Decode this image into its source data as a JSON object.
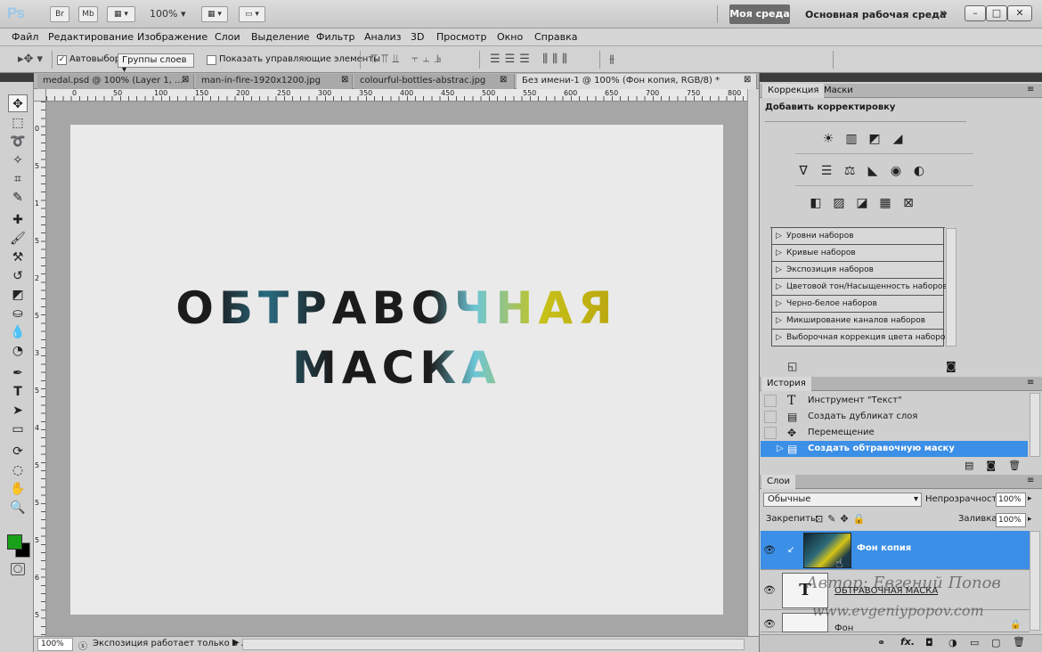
{
  "titlebar": {
    "logo": "Ps",
    "btn_br": "Br",
    "btn_mb": "Mb",
    "zoom": "100%",
    "workspace_active": "Моя среда",
    "workspace_main": "Основная рабочая среда",
    "more": "»",
    "minimize": "–",
    "maximize": "□",
    "close": "✕"
  },
  "menu": [
    "Файл",
    "Редактирование",
    "Изображение",
    "Слои",
    "Выделение",
    "Фильтр",
    "Анализ",
    "3D",
    "Просмотр",
    "Окно",
    "Справка"
  ],
  "options": {
    "auto_select_label": "Автовыбор:",
    "auto_select_value": "Группы слоев",
    "show_controls_label": "Показать управляющие элементы"
  },
  "tabs": [
    {
      "label": "medal.psd @ 100% (Layer 1, ..."
    },
    {
      "label": "man-in-fire-1920x1200.jpg"
    },
    {
      "label": "colourful-bottles-abstrac.jpg"
    },
    {
      "label": "Без имени-1 @ 100% (Фон копия, RGB/8) *"
    }
  ],
  "ruler_top": [
    "0",
    "50",
    "100",
    "150",
    "200",
    "250",
    "300",
    "350",
    "400",
    "450",
    "500",
    "550",
    "600",
    "650",
    "700",
    "750",
    "800"
  ],
  "ruler_left": [
    "0",
    "5",
    "1",
    "5",
    "2",
    "5",
    "3",
    "5",
    "4",
    "5",
    "5",
    "5",
    "6",
    "5"
  ],
  "canvas": {
    "line1": "ОБТРАВОЧНАЯ",
    "line2": "МАСКА"
  },
  "status": {
    "zoom": "100%",
    "text": "Экспозиция работает только в ..."
  },
  "adjustments": {
    "tabs": [
      "Коррекция",
      "Маски"
    ],
    "heading": "Добавить корректировку",
    "row1": [
      "☀",
      "▥",
      "◩",
      "◢"
    ],
    "row2": [
      "∇",
      "☰",
      "⚖",
      "◣",
      "◉",
      "◐"
    ],
    "row3": [
      "◧",
      "▨",
      "◪",
      "▦",
      "⊠"
    ],
    "presets": [
      "Уровни наборов",
      "Кривые наборов",
      "Экспозиция наборов",
      "Цветовой тон/Насыщенность наборов",
      "Черно-белое наборов",
      "Микширование каналов наборов",
      "Выборочная коррекция цвета наборов"
    ]
  },
  "history": {
    "title": "История",
    "items": [
      {
        "label": "Инструмент \"Текст\"",
        "icon": "T"
      },
      {
        "label": "Создать дубликат слоя",
        "icon": "▤"
      },
      {
        "label": "Перемещение",
        "icon": "✥"
      },
      {
        "label": "Создать обтравочную маску",
        "icon": "▤"
      }
    ]
  },
  "layers": {
    "title": "Слои",
    "blend_mode": "Обычные",
    "opacity_label": "Непрозрачность:",
    "opacity_value": "100%",
    "lock_label": "Закрепить:",
    "fill_label": "Заливка:",
    "fill_value": "100%",
    "items": [
      {
        "name": "Фон копия",
        "thumb": "",
        "selected": true
      },
      {
        "name": "ОБТРАВОЧНАЯ  МАСКА",
        "thumb": "T",
        "selected": false
      },
      {
        "name": "Фон",
        "thumb": "",
        "selected": false
      }
    ],
    "footer_icons": [
      "⚭",
      "fx.",
      "◘",
      "◑",
      "▭",
      "▢",
      "🗑"
    ]
  },
  "watermark": {
    "line1": "Автор: Евгений Попов",
    "line2": "www.evgeniypopov.com"
  },
  "colors": {
    "accent": "#3b8fe6",
    "foreground": "#1aa11a",
    "background": "#000000"
  }
}
